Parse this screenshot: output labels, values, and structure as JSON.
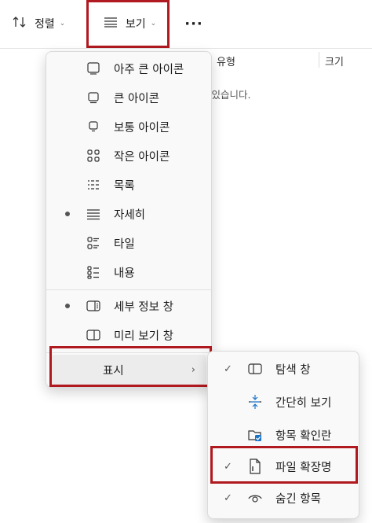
{
  "toolbar": {
    "sort_label": "정렬",
    "view_label": "보기",
    "more_label": "···"
  },
  "columns": {
    "type": "유형",
    "size": "크기"
  },
  "empty_message": "에 있습니다.",
  "view_menu": {
    "items": [
      {
        "label": "아주 큰 아이콘",
        "icon": "extra-large-icons-icon",
        "selected": false
      },
      {
        "label": "큰 아이콘",
        "icon": "large-icons-icon",
        "selected": false
      },
      {
        "label": "보통 아이콘",
        "icon": "medium-icons-icon",
        "selected": false
      },
      {
        "label": "작은 아이콘",
        "icon": "small-icons-icon",
        "selected": false
      },
      {
        "label": "목록",
        "icon": "list-icon",
        "selected": false
      },
      {
        "label": "자세히",
        "icon": "details-icon",
        "selected": true
      },
      {
        "label": "타일",
        "icon": "tiles-icon",
        "selected": false
      },
      {
        "label": "내용",
        "icon": "content-icon",
        "selected": false
      }
    ],
    "panes": [
      {
        "label": "세부 정보 창",
        "icon": "details-pane-icon",
        "selected": true
      },
      {
        "label": "미리 보기 창",
        "icon": "preview-pane-icon",
        "selected": false
      }
    ],
    "show_label": "표시"
  },
  "show_menu": {
    "items": [
      {
        "label": "탐색 창",
        "icon": "navigation-pane-icon",
        "checked": true
      },
      {
        "label": "간단히 보기",
        "icon": "compact-view-icon",
        "checked": false
      },
      {
        "label": "항목 확인란",
        "icon": "item-checkboxes-icon",
        "checked": false
      },
      {
        "label": "파일 확장명",
        "icon": "file-extensions-icon",
        "checked": true
      },
      {
        "label": "숨긴 항목",
        "icon": "hidden-items-icon",
        "checked": true
      }
    ]
  },
  "colors": {
    "highlight": "#b0191f",
    "accent": "#1a73c8"
  }
}
